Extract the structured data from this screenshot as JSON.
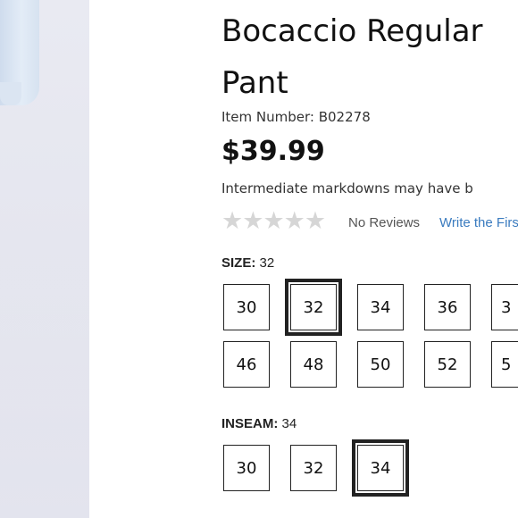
{
  "product": {
    "title_line1": "Bocaccio Regular",
    "title_line2": "Pant",
    "item_number": "Item Number: B02278",
    "price": "$39.99",
    "markdown_note": "Intermediate markdowns may have b",
    "reviews": {
      "rating": 0,
      "max_stars": 5,
      "count_text": "No Reviews",
      "write_link": "Write the Firs"
    }
  },
  "size": {
    "label": "SIZE:",
    "selected": "32",
    "row1": [
      "30",
      "32",
      "34",
      "36",
      "3"
    ],
    "row2": [
      "46",
      "48",
      "50",
      "52",
      "5"
    ]
  },
  "inseam": {
    "label": "INSEAM:",
    "selected": "34",
    "options": [
      "30",
      "32",
      "34"
    ]
  },
  "colors": {
    "text": "#111111",
    "link": "#3a7bbf",
    "star_empty": "#d6d6d6",
    "border": "#222222"
  }
}
